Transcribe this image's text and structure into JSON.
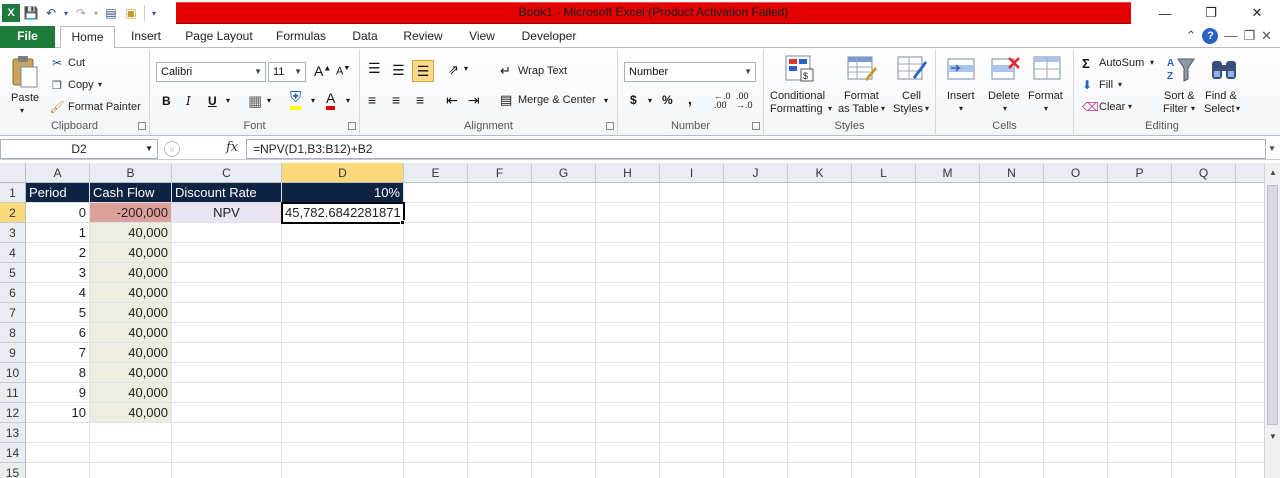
{
  "window": {
    "title": "Book1  -  Microsoft Excel (Product Activation Failed)"
  },
  "tabs": [
    "File",
    "Home",
    "Insert",
    "Page Layout",
    "Formulas",
    "Data",
    "Review",
    "View",
    "Developer"
  ],
  "ribbon": {
    "clipboard": {
      "label": "Clipboard",
      "paste": "Paste",
      "cut": "Cut",
      "copy": "Copy",
      "format_painter": "Format Painter"
    },
    "font": {
      "label": "Font",
      "name": "Calibri",
      "size": "11"
    },
    "alignment": {
      "label": "Alignment",
      "wrap_text": "Wrap Text",
      "merge_center": "Merge & Center"
    },
    "number": {
      "label": "Number",
      "format": "Number"
    },
    "styles": {
      "label": "Styles",
      "conditional": "Conditional",
      "formatting": "Formatting",
      "format": "Format",
      "as_table": "as Table",
      "cell": "Cell",
      "styles": "Styles"
    },
    "cells": {
      "label": "Cells",
      "insert": "Insert",
      "delete": "Delete",
      "format": "Format"
    },
    "editing": {
      "label": "Editing",
      "autosum": "AutoSum",
      "fill": "Fill",
      "clear": "Clear",
      "sort": "Sort &",
      "filter": "Filter",
      "find": "Find &",
      "select": "Select"
    }
  },
  "formula_bar": {
    "name_box": "D2",
    "formula": "=NPV(D1,B3:B12)+B2"
  },
  "sheet": {
    "columns": [
      "A",
      "B",
      "C",
      "D",
      "E",
      "F",
      "G",
      "H",
      "I",
      "J",
      "K",
      "L",
      "M",
      "N",
      "O",
      "P",
      "Q"
    ],
    "rows": [
      "1",
      "2",
      "3",
      "4",
      "5",
      "6",
      "7",
      "8",
      "9",
      "10",
      "11",
      "12",
      "13",
      "14",
      "15"
    ],
    "header": {
      "period": "Period",
      "cash_flow": "Cash Flow",
      "discount_rate": "Discount Rate",
      "rate": "10%"
    },
    "npv_label": "NPV",
    "npv_value": "45,782.6842281871",
    "periods": [
      "0",
      "1",
      "2",
      "3",
      "4",
      "5",
      "6",
      "7",
      "8",
      "9",
      "10"
    ],
    "cash_flows": [
      "-200,000",
      "40,000",
      "40,000",
      "40,000",
      "40,000",
      "40,000",
      "40,000",
      "40,000",
      "40,000",
      "40,000",
      "40,000"
    ],
    "active_cell": "D2"
  },
  "colors": {
    "title_band": "#e30000",
    "file_tab": "#1d7a3c",
    "header_fill": "#0f2342",
    "negative_fill": "#dca09b",
    "cashflow_fill": "#eeede2",
    "npv_label_fill": "#e9e4f0",
    "selection_header": "#f9d97a"
  }
}
